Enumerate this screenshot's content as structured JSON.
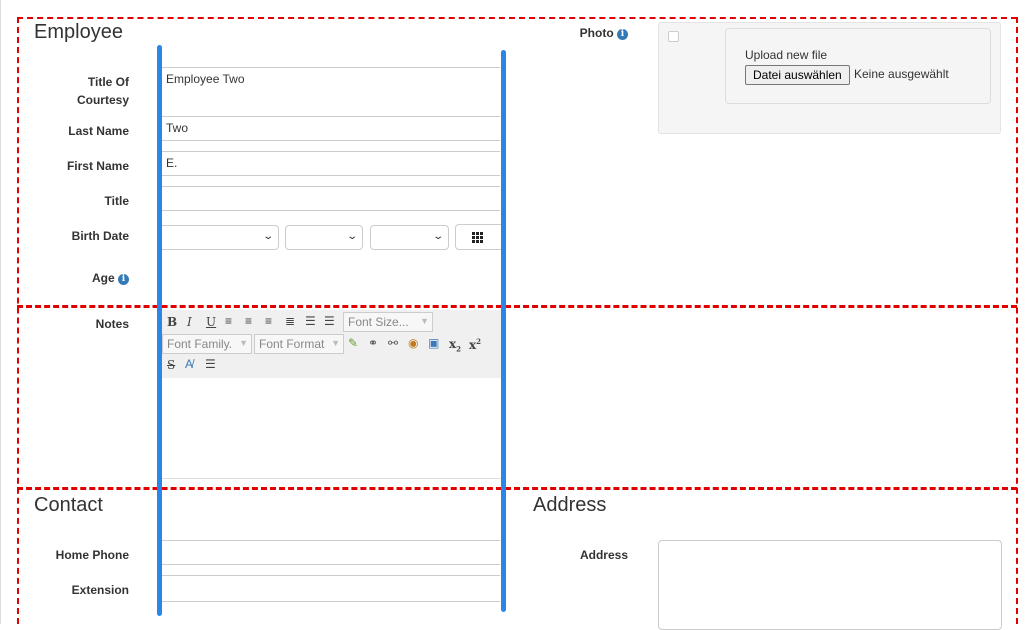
{
  "employee_section": {
    "title": "Employee",
    "fields": {
      "title_of_courtesy": {
        "label_line1": "Title Of",
        "label_line2": "Courtesy",
        "value": "Employee Two"
      },
      "last_name": {
        "label": "Last Name",
        "value": "Two"
      },
      "first_name": {
        "label": "First Name",
        "value": "E."
      },
      "title": {
        "label": "Title",
        "value": ""
      },
      "birth_date": {
        "label": "Birth Date"
      },
      "age": {
        "label": "Age"
      }
    }
  },
  "photo": {
    "label": "Photo",
    "upload_label": "Upload new file",
    "choose_button": "Datei auswählen",
    "no_file_text": "Keine ausgewählt"
  },
  "notes": {
    "label": "Notes",
    "toolbar": {
      "font_size": "Font Size...",
      "font_family": "Font Family.",
      "font_format": "Font Format"
    }
  },
  "contact_section": {
    "title": "Contact",
    "home_phone_label": "Home Phone",
    "extension_label": "Extension"
  },
  "address_section": {
    "title": "Address",
    "address_label": "Address"
  },
  "colors": {
    "highlight_bar": "#2b86ea",
    "section_border": "#e00000",
    "info_icon": "#337ab7"
  }
}
